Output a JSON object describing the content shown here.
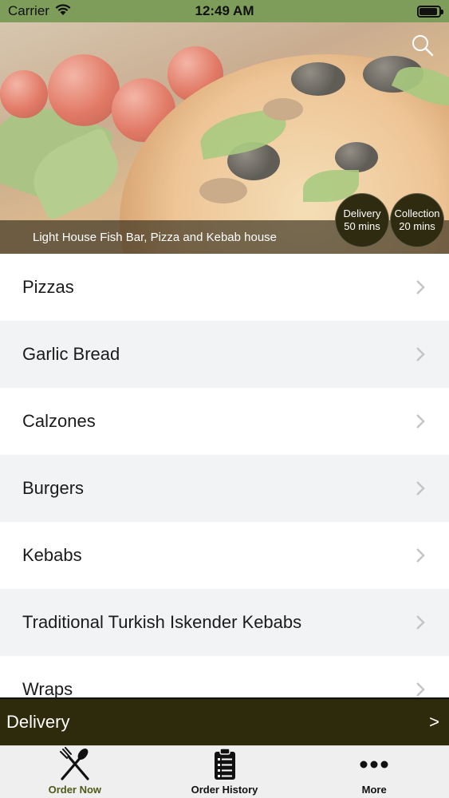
{
  "status_bar": {
    "carrier": "Carrier",
    "time": "12:49 AM",
    "battery_level": 0.9
  },
  "hero": {
    "restaurant_name": "Light House Fish Bar, Pizza and Kebab house",
    "delivery": {
      "label": "Delivery",
      "time": "50 mins"
    },
    "collection": {
      "label": "Collection",
      "time": "20 mins"
    },
    "search_icon": "search-icon"
  },
  "menu": {
    "categories": [
      {
        "label": "Pizzas"
      },
      {
        "label": "Garlic Bread"
      },
      {
        "label": "Calzones"
      },
      {
        "label": "Burgers"
      },
      {
        "label": "Kebabs"
      },
      {
        "label": "Traditional Turkish Iskender Kebabs"
      },
      {
        "label": "Wraps"
      }
    ]
  },
  "delivery_bar": {
    "label": "Delivery",
    "arrow": ">"
  },
  "tabs": [
    {
      "label": "Order Now",
      "icon": "fork-knife-icon",
      "active": true
    },
    {
      "label": "Order History",
      "icon": "clipboard-list-icon",
      "active": false
    },
    {
      "label": "More",
      "icon": "more-dots-icon",
      "active": false
    }
  ],
  "colors": {
    "status_bar": "#7e9d5a",
    "accent_dark": "#2e2a0c",
    "active_tab": "#4e5a16"
  }
}
